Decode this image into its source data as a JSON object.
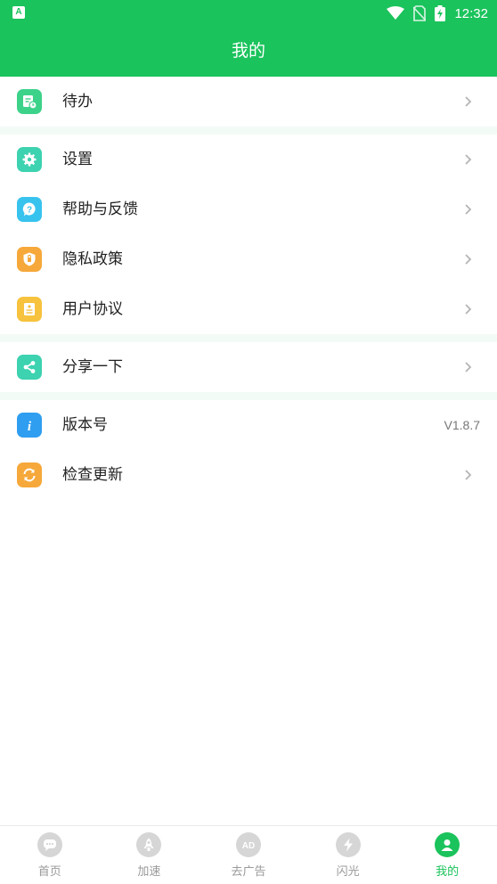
{
  "status_bar": {
    "time": "12:32",
    "left_icon_letter": "A"
  },
  "header": {
    "title": "我的"
  },
  "sections": [
    {
      "items": [
        {
          "label": "待办",
          "icon": "todo-icon",
          "color": "#3dd28a"
        }
      ]
    },
    {
      "items": [
        {
          "label": "设置",
          "icon": "gear-icon",
          "color": "#3dd2b0"
        },
        {
          "label": "帮助与反馈",
          "icon": "help-icon",
          "color": "#38c3ee"
        },
        {
          "label": "隐私政策",
          "icon": "shield-icon",
          "color": "#f6a83a"
        },
        {
          "label": "用户协议",
          "icon": "document-icon",
          "color": "#f7c23d"
        }
      ]
    },
    {
      "items": [
        {
          "label": "分享一下",
          "icon": "share-icon",
          "color": "#3dd2b0"
        }
      ]
    },
    {
      "items": [
        {
          "label": "版本号",
          "icon": "info-icon",
          "color": "#2f9ef0",
          "value": "V1.8.7"
        },
        {
          "label": "检查更新",
          "icon": "refresh-icon",
          "color": "#f6a83a"
        }
      ]
    }
  ],
  "tabs": [
    {
      "label": "首页",
      "icon": "chat-icon",
      "active": false
    },
    {
      "label": "加速",
      "icon": "rocket-icon",
      "active": false
    },
    {
      "label": "去广告",
      "icon": "ad-icon",
      "active": false
    },
    {
      "label": "闪光",
      "icon": "lightning-icon",
      "active": false
    },
    {
      "label": "我的",
      "icon": "person-icon",
      "active": true
    }
  ],
  "colors": {
    "brand": "#1bc35c",
    "section_gap": "#f3fbf6",
    "inactive_tab": "#9a9a9a"
  }
}
